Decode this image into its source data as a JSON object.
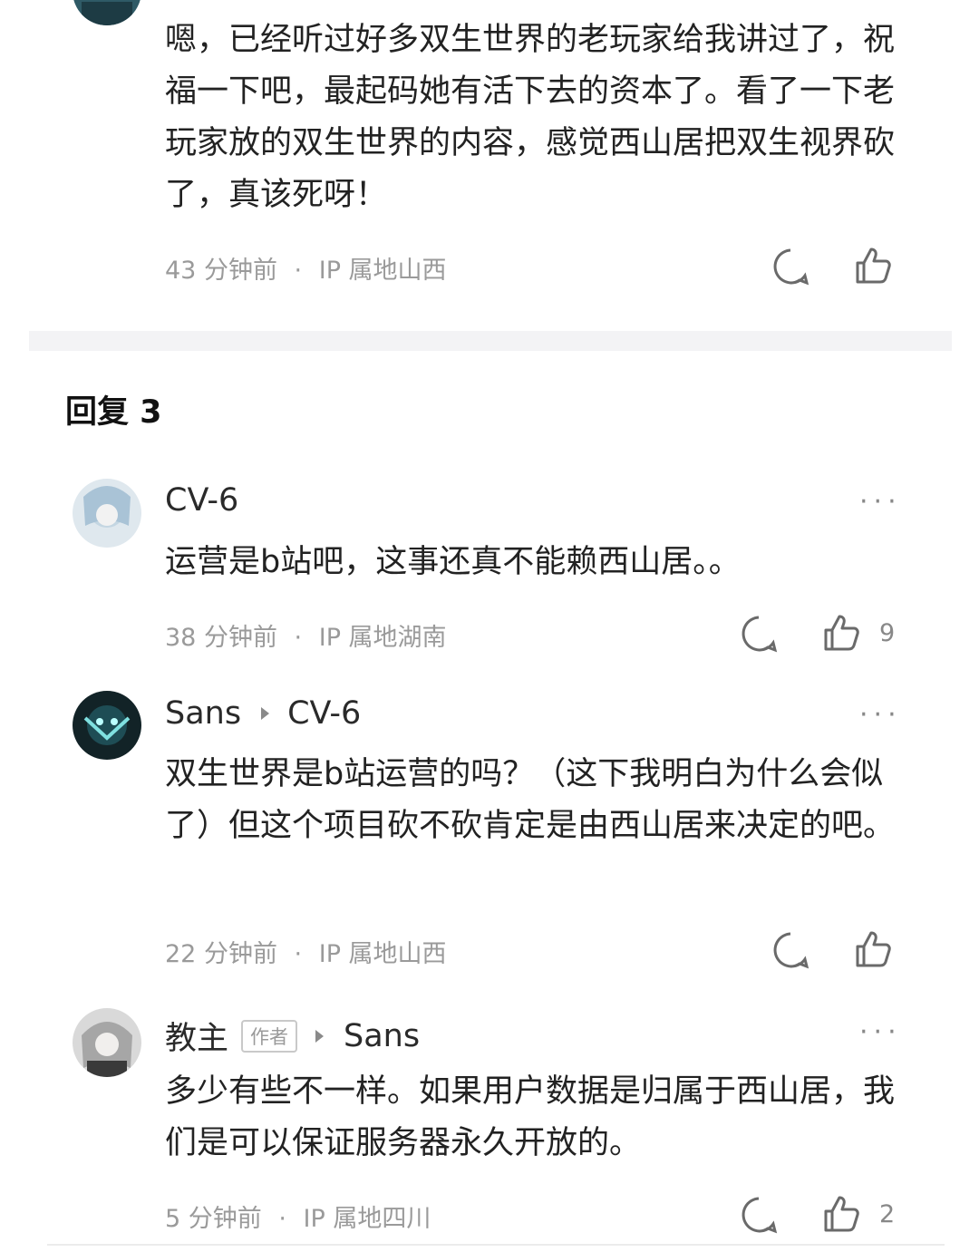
{
  "top_comment": {
    "text": "嗯，已经听过好多双生世界的老玩家给我讲过了，祝福一下吧，最起码她有活下去的资本了。看了一下老玩家放的双生世界的内容，感觉西山居把双生视界砍了，真该死呀！",
    "time": "43 分钟前",
    "ip": "IP 属地山西"
  },
  "replies_header": "回复 3",
  "replies": [
    {
      "name": "CV-6",
      "text": "运营是b站吧，这事还真不能赖西山居。。",
      "time": "38 分钟前",
      "ip": "IP 属地湖南",
      "likes": "9"
    },
    {
      "name": "Sans",
      "reply_to": "CV-6",
      "text": "双生世界是b站运营的吗？（这下我明白为什么会似了）但这个项目砍不砍肯定是由西山居来决定的吧。",
      "time": "22 分钟前",
      "ip": "IP 属地山西"
    },
    {
      "name": "教主",
      "badge": "作者",
      "reply_to": "Sans",
      "text": "多少有些不一样。如果用户数据是归属于西山居，我们是可以保证服务器永久开放的。",
      "time": "5 分钟前",
      "ip": "IP 属地四川",
      "likes": "2"
    }
  ],
  "separator_dot": "·",
  "more_label": "···",
  "icons": [
    "comment-icon",
    "thumbs-up-icon",
    "more-icon",
    "reply-arrow-icon"
  ],
  "colors": {
    "text": "#222222",
    "meta": "#9a9a9a",
    "background": "#ffffff",
    "divider": "#f3f3f5"
  }
}
